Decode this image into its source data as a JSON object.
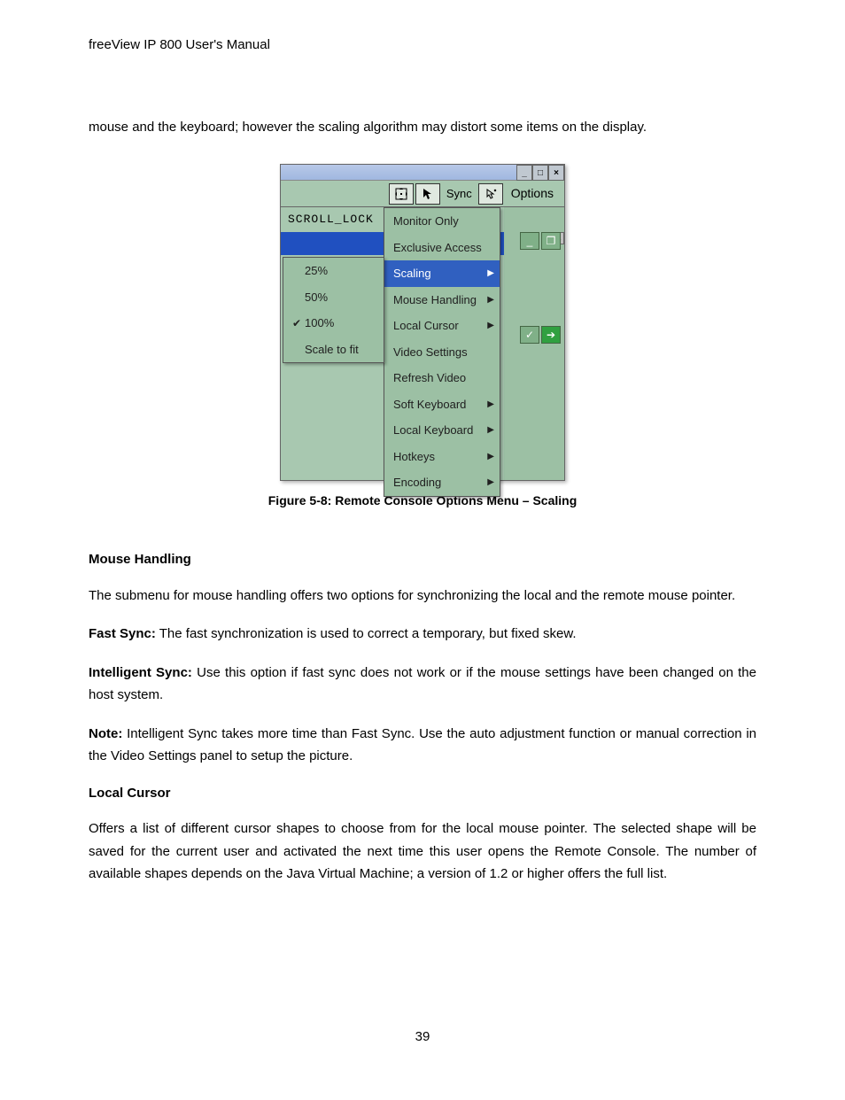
{
  "header": "freeView IP 800 User's Manual",
  "intro": "mouse and the keyboard; however the scaling algorithm may distort some items on the display.",
  "screenshot": {
    "win_min": "_",
    "win_max": "□",
    "win_close": "×",
    "sync_label": "Sync",
    "options_label": "Options",
    "scroll_lock": "SCROLL_LOCK",
    "scaling_menu": [
      {
        "label": "25%",
        "checked": false
      },
      {
        "label": "50%",
        "checked": false
      },
      {
        "label": "100%",
        "checked": true
      },
      {
        "label": "Scale to fit",
        "checked": false
      }
    ],
    "main_menu": [
      {
        "label": "Monitor Only",
        "arrow": false,
        "hl": false
      },
      {
        "label": "Exclusive Access",
        "arrow": false,
        "hl": false
      },
      {
        "label": "Scaling",
        "arrow": true,
        "hl": true
      },
      {
        "label": "Mouse Handling",
        "arrow": true,
        "hl": false
      },
      {
        "label": "Local Cursor",
        "arrow": true,
        "hl": false
      },
      {
        "label": "Video Settings",
        "arrow": false,
        "hl": false
      },
      {
        "label": "Refresh Video",
        "arrow": false,
        "hl": false
      },
      {
        "label": "Soft Keyboard",
        "arrow": true,
        "hl": false
      },
      {
        "label": "Local Keyboard",
        "arrow": true,
        "hl": false
      },
      {
        "label": "Hotkeys",
        "arrow": true,
        "hl": false
      },
      {
        "label": "Encoding",
        "arrow": true,
        "hl": false
      }
    ]
  },
  "figure_caption": "Figure 5-8: Remote Console Options Menu – Scaling",
  "sections": {
    "mouse_handling": {
      "title": "Mouse Handling",
      "p1": "The submenu for mouse handling offers two options for synchronizing the local and the remote mouse pointer.",
      "fast_sync_label": "Fast Sync:",
      "fast_sync_text": " The fast synchronization is used to correct a temporary, but fixed skew.",
      "int_sync_label": "Intelligent Sync:",
      "int_sync_text": " Use this option if fast sync does not work or if the mouse settings have been changed on the host system.",
      "note_label": "Note:",
      "note_text": " Intelligent Sync takes more time than Fast Sync. Use the auto adjustment function or manual correction in the Video Settings panel to setup the picture."
    },
    "local_cursor": {
      "title": "Local Cursor",
      "p1": "Offers a list of different cursor shapes to choose from for the local mouse pointer. The selected shape will be saved for the current user and activated the next time this user opens the Remote Console. The number of available shapes depends on the Java Virtual Machine; a version of 1.2 or higher offers the full list."
    }
  },
  "page_number": "39"
}
